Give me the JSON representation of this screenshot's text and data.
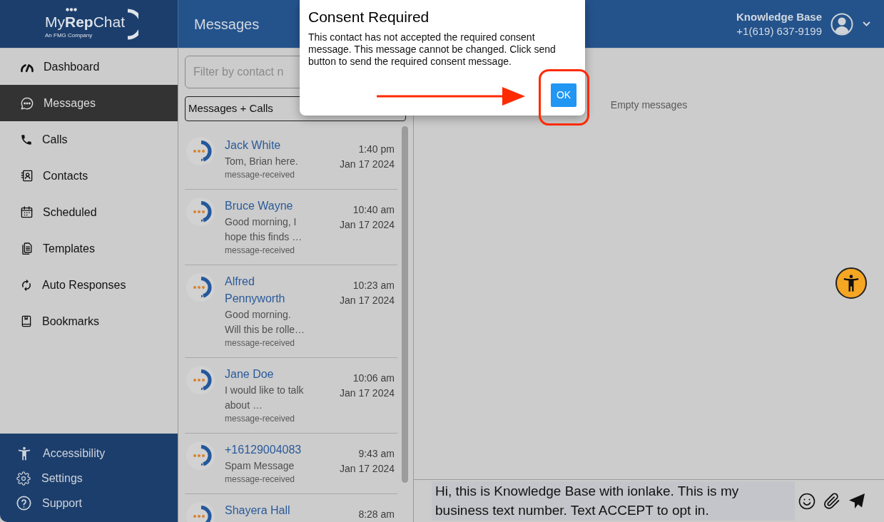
{
  "logo": {
    "wordmark": "My**Rep**Chat",
    "tagline": "An FMG Company"
  },
  "header": {
    "title": "Messages",
    "user": {
      "name": "Knowledge Base",
      "phone": "+1(619) 637-9199"
    }
  },
  "sidebar": {
    "items": [
      {
        "label": "Dashboard",
        "selected": false
      },
      {
        "label": "Messages",
        "selected": true
      },
      {
        "label": "Calls",
        "selected": false
      },
      {
        "label": "Contacts",
        "selected": false
      },
      {
        "label": "Scheduled",
        "selected": false
      },
      {
        "label": "Templates",
        "selected": false
      },
      {
        "label": "Auto Responses",
        "selected": false
      },
      {
        "label": "Bookmarks",
        "selected": false
      }
    ],
    "footer_items": [
      {
        "label": "Accessibility"
      },
      {
        "label": "Settings"
      },
      {
        "label": "Support"
      }
    ]
  },
  "conversation_list": {
    "filter": {
      "placeholder": "Filter by contact n"
    },
    "type_select": {
      "value": "Messages + Calls"
    },
    "items": [
      {
        "name": "Jack White",
        "preview": "Tom, Brian here.",
        "status": "message-received",
        "time": "1:40 pm",
        "date": "Jan 17 2024"
      },
      {
        "name": "Bruce Wayne",
        "preview": "Good morning, I hope this finds …",
        "status": "message-received",
        "time": "10:40 am",
        "date": "Jan 17 2024"
      },
      {
        "name": "Alfred Pennyworth",
        "preview": "Good morning. Will this be rolle…",
        "status": "message-received",
        "time": "10:23 am",
        "date": "Jan 17 2024"
      },
      {
        "name": "Jane Doe",
        "preview": "I would like to talk about …",
        "status": "message-received",
        "time": "10:06 am",
        "date": "Jan 17 2024"
      },
      {
        "name": "+16129004083",
        "preview": "Spam Message",
        "status": "message-received",
        "time": "9:43 am",
        "date": "Jan 17 2024"
      },
      {
        "name": "Shayera Hall",
        "time": "8:28 am"
      }
    ]
  },
  "thread": {
    "empty_text": "Empty messages",
    "compose": {
      "value": "Hi, this is Knowledge Base with ionlake. This is my business text number. Text ACCEPT to opt in."
    }
  },
  "dialog": {
    "title": "Consent Required",
    "message": "This contact has not accepted the required consent message. This message cannot be changed. Click send button to send the required consent message.",
    "buttons": [
      "OK"
    ]
  },
  "annotation": {
    "arrow": true,
    "ring": true
  }
}
